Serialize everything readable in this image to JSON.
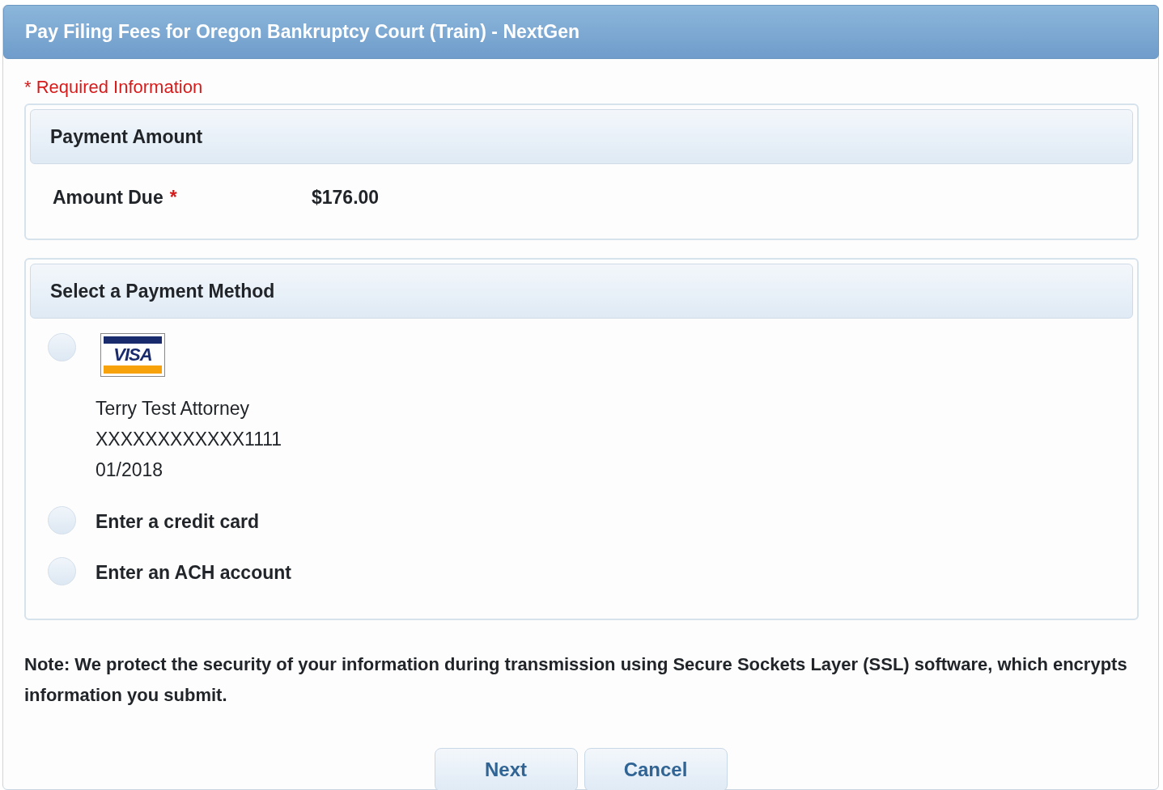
{
  "window": {
    "title": "Pay Filing Fees for Oregon Bankruptcy Court (Train) - NextGen"
  },
  "required_note": {
    "marker": "*",
    "text": "Required Information"
  },
  "payment_amount": {
    "heading": "Payment Amount",
    "label": "Amount Due",
    "required_marker": "*",
    "value": "$176.00"
  },
  "payment_method": {
    "heading": "Select a Payment Method",
    "options": [
      {
        "kind": "saved_card",
        "selected": false,
        "brand": "VISA",
        "holder": "Terry Test Attorney",
        "number": "XXXXXXXXXXXX1111",
        "expiry": "01/2018"
      },
      {
        "kind": "option",
        "selected": false,
        "label": "Enter a credit card"
      },
      {
        "kind": "option",
        "selected": false,
        "label": "Enter an ACH account"
      }
    ]
  },
  "note": "Note: We protect the security of your information during transmission using Secure Sockets Layer (SSL) software, which encrypts information you submit.",
  "buttons": [
    "Next",
    "Cancel"
  ]
}
